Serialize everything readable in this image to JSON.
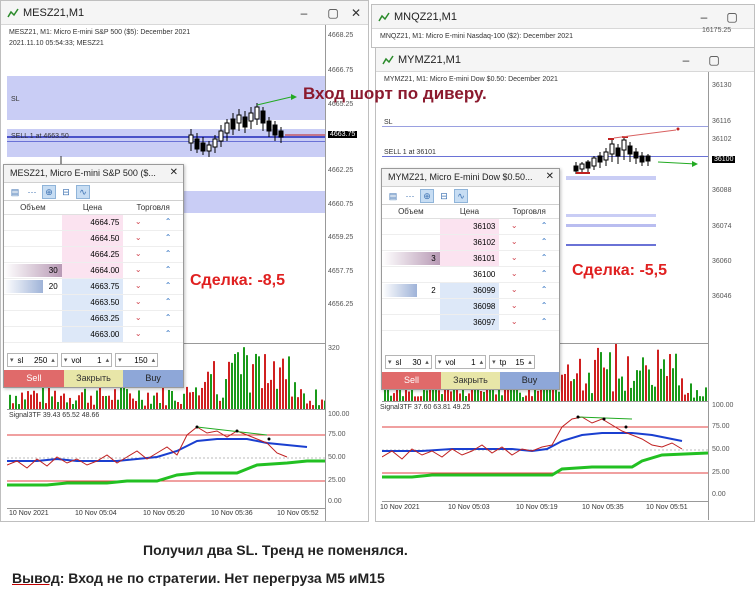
{
  "win_left": {
    "title": "MESZ21,M1",
    "info_line": "MESZ21, M1: Micro E-mini S&P 500 ($5): December 2021",
    "timestamp": "2021.11.10 05:54:33; MESZ21",
    "price_labels": [
      "4668.25",
      "4666.75",
      "4665.25",
      "4663.75",
      "4662.25",
      "4660.75",
      "4659.25",
      "4657.75",
      "4656.25"
    ],
    "current_price": "4663.75",
    "sl_label": "SL",
    "sell_label": "SELL 1 at 4663.50",
    "volume_max_label": "320",
    "indicator_label": "Signal3TF 39.43 65.52 48.66",
    "indicator_levels": [
      "100.00",
      "75.00",
      "50.00",
      "25.00",
      "0.00"
    ],
    "time_labels": [
      "10 Nov 2021",
      "10 Nov 05:04",
      "10 Nov 05:20",
      "10 Nov 05:36",
      "10 Nov 05:52"
    ]
  },
  "win_mnq": {
    "title": "MNQZ21,M1",
    "info_line": "MNQZ21, M1: Micro E-mini Nasdaq-100 ($2): December 2021",
    "price_label": "16175.25"
  },
  "win_right": {
    "title": "MYMZ21,M1",
    "info_line": "MYMZ21, M1: Micro E-mini Dow $0.50: December 2021",
    "price_labels": [
      "36130",
      "36116",
      "36102",
      "36088",
      "36074",
      "36060",
      "36046"
    ],
    "current_price": "36100",
    "sl_label": "SL",
    "sell_label": "SELL 1 at 36101",
    "indicator_label": "Signal3TF 37.60 63.81 49.25",
    "indicator_levels": [
      "100.00",
      "75.00",
      "50.00",
      "25.00",
      "0.00"
    ],
    "time_labels": [
      "10 Nov 2021",
      "10 Nov 05:03",
      "10 Nov 05:19",
      "10 Nov 05:35",
      "10 Nov 05:51"
    ]
  },
  "dom_left": {
    "title": "MESZ21, Micro E-mini S&P 500 ($...",
    "headers": [
      "Объем",
      "Цена",
      "Торговля"
    ],
    "rows": [
      {
        "vol": "",
        "price": "4664.75",
        "side": "ask",
        "bar": 0
      },
      {
        "vol": "",
        "price": "4664.50",
        "side": "ask",
        "bar": 0
      },
      {
        "vol": "",
        "price": "4664.25",
        "side": "ask",
        "bar": 0
      },
      {
        "vol": "30",
        "price": "4664.00",
        "side": "ask",
        "bar": 1.0
      },
      {
        "vol": "20",
        "price": "4663.75",
        "side": "bid",
        "bar": 0.67
      },
      {
        "vol": "",
        "price": "4663.50",
        "side": "bid",
        "bar": 0
      },
      {
        "vol": "",
        "price": "4663.25",
        "side": "bid",
        "bar": 0
      },
      {
        "vol": "",
        "price": "4663.00",
        "side": "bid",
        "bar": 0
      }
    ],
    "sl_label": "sl",
    "sl_value": "250",
    "vol_label": "vol",
    "vol_value": "1",
    "tp_value": "150",
    "sell": "Sell",
    "close": "Закрыть",
    "buy": "Buy"
  },
  "dom_right": {
    "title": "MYMZ21, Micro E-mini Dow $0.50...",
    "headers": [
      "Объем",
      "Цена",
      "Торговля"
    ],
    "rows": [
      {
        "vol": "",
        "price": "36103",
        "side": "ask",
        "bar": 0
      },
      {
        "vol": "",
        "price": "36102",
        "side": "ask",
        "bar": 0
      },
      {
        "vol": "3",
        "price": "36101",
        "side": "ask",
        "bar": 1.0
      },
      {
        "vol": "",
        "price": "36100",
        "side": "mid",
        "bar": 0
      },
      {
        "vol": "2",
        "price": "36099",
        "side": "bid",
        "bar": 0.6
      },
      {
        "vol": "",
        "price": "36098",
        "side": "bid",
        "bar": 0
      },
      {
        "vol": "",
        "price": "36097",
        "side": "bid",
        "bar": 0
      }
    ],
    "sl_label": "sl",
    "sl_value": "30",
    "vol_label": "vol",
    "vol_value": "1",
    "tp_label": "tp",
    "tp_value": "15",
    "sell": "Sell",
    "close": "Закрыть",
    "buy": "Buy"
  },
  "annotations": {
    "entry": "Вход шорт по диверу.",
    "trade_left": "Сделка: -8,5",
    "trade_right": "Сделка: -5,5"
  },
  "caption": {
    "line1": "Получил два SL. Тренд не поменялся.",
    "conclusion_label": "Вывод",
    "line2": ":  Вход не по стратегии. Нет перегруза М5 иМ15"
  },
  "colors": {
    "band_blue": "#c9cdf5",
    "band_dark": "#6a72d6",
    "fast_line": "#c02020",
    "mid_line": "#1a3fd0",
    "slow_line": "#22c022",
    "up_bar": "#1a9a1a",
    "down_bar": "#d02020",
    "annotation_red": "#e02020",
    "annotation_dark": "#8b1a2e"
  }
}
